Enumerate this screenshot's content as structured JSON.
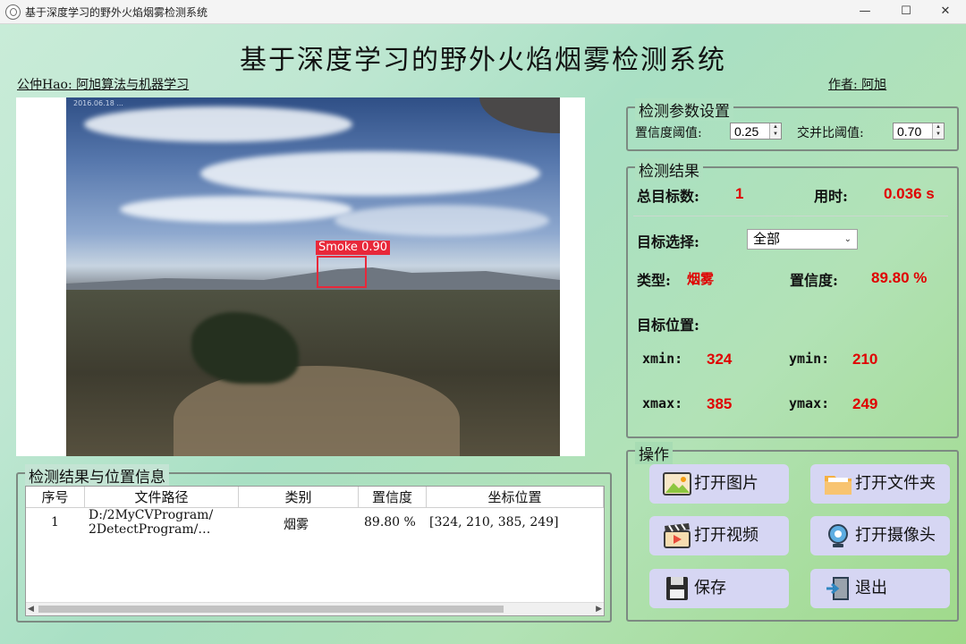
{
  "window": {
    "title": "基于深度学习的野外火焰烟雾检测系统",
    "minimize": "—",
    "maximize": "☐",
    "close": "✕"
  },
  "header": {
    "title": "基于深度学习的野外火焰烟雾检测系统",
    "left_link": "公仲Hao: 阿旭算法与机器学习",
    "right_link": "作者: 阿旭"
  },
  "image_view": {
    "detection_label": "Smoke 0.90",
    "timestamp_overlay": "2016.06.18 ..."
  },
  "params": {
    "title": "检测参数设置",
    "conf_label": "置信度阈值:",
    "conf_value": "0.25",
    "iou_label": "交并比阈值:",
    "iou_value": "0.70"
  },
  "results": {
    "title": "检测结果",
    "total_label": "总目标数:",
    "total_value": "1",
    "time_label": "用时:",
    "time_value": "0.036 s",
    "target_select_label": "目标选择:",
    "target_select_value": "全部",
    "type_label": "类型:",
    "type_value": "烟雾",
    "conf_label": "置信度:",
    "conf_value": "89.80 %",
    "position_label": "目标位置:",
    "xmin_label": "xmin:",
    "xmin_value": "324",
    "ymin_label": "ymin:",
    "ymin_value": "210",
    "xmax_label": "xmax:",
    "xmax_value": "385",
    "ymax_label": "ymax:",
    "ymax_value": "249"
  },
  "operations": {
    "title": "操作",
    "open_image": "打开图片",
    "open_folder": "打开文件夹",
    "open_video": "打开视频",
    "open_camera": "打开摄像头",
    "save": "保存",
    "exit": "退出"
  },
  "table": {
    "title": "检测结果与位置信息",
    "columns": [
      "序号",
      "文件路径",
      "类别",
      "置信度",
      "坐标位置"
    ],
    "rows": [
      {
        "index": "1",
        "path_line1": "D:/2MyCVProgram/",
        "path_line2": "2DetectProgram/…",
        "category": "烟雾",
        "confidence": "89.80 %",
        "coords": "[324, 210, 385, 249]"
      }
    ]
  },
  "colors": {
    "accent_red": "#e00000",
    "button_bg": "#d6d6f3",
    "bbox_red": "#e8283a"
  }
}
